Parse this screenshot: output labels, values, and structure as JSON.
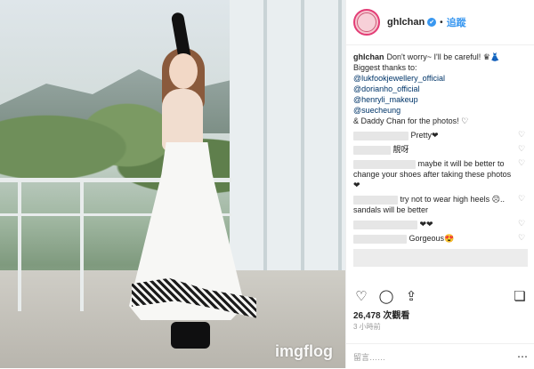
{
  "photo": {
    "watermark": "imgflog"
  },
  "header": {
    "username": "ghlchan",
    "verified": true,
    "separator": "•",
    "follow_label": "追蹤"
  },
  "caption": {
    "username": "ghlchan",
    "text_line1": "Don't worry~ I'll be careful! ♛👗",
    "text_line2": "Biggest thanks to:",
    "mentions": [
      "@lukfookjewellery_official",
      "@dorianho_official",
      "@henryli_makeup",
      "@suecheung"
    ],
    "closing": "& Daddy Chan for the photos! ♡"
  },
  "comments": [
    {
      "text": "Pretty❤"
    },
    {
      "text": "靚呀"
    },
    {
      "text": "maybe it will be better to change your shoes after taking these photos ❤"
    },
    {
      "text": "try not to wear high heels ☹.. sandals will be better"
    },
    {
      "text": "❤❤"
    },
    {
      "text": "Gorgeous😍"
    }
  ],
  "actions": {
    "like_icon": "heart-icon",
    "comment_icon": "comment-icon",
    "share_icon": "share-icon",
    "save_icon": "bookmark-icon"
  },
  "stats": {
    "views": "26,478 次觀看",
    "time": "3 小時前"
  },
  "comment_bar": {
    "placeholder": "留言……",
    "more": "⋯"
  },
  "colors": {
    "link": "#003569",
    "accent": "#3897f0",
    "text": "#262626",
    "muted": "#999999"
  }
}
